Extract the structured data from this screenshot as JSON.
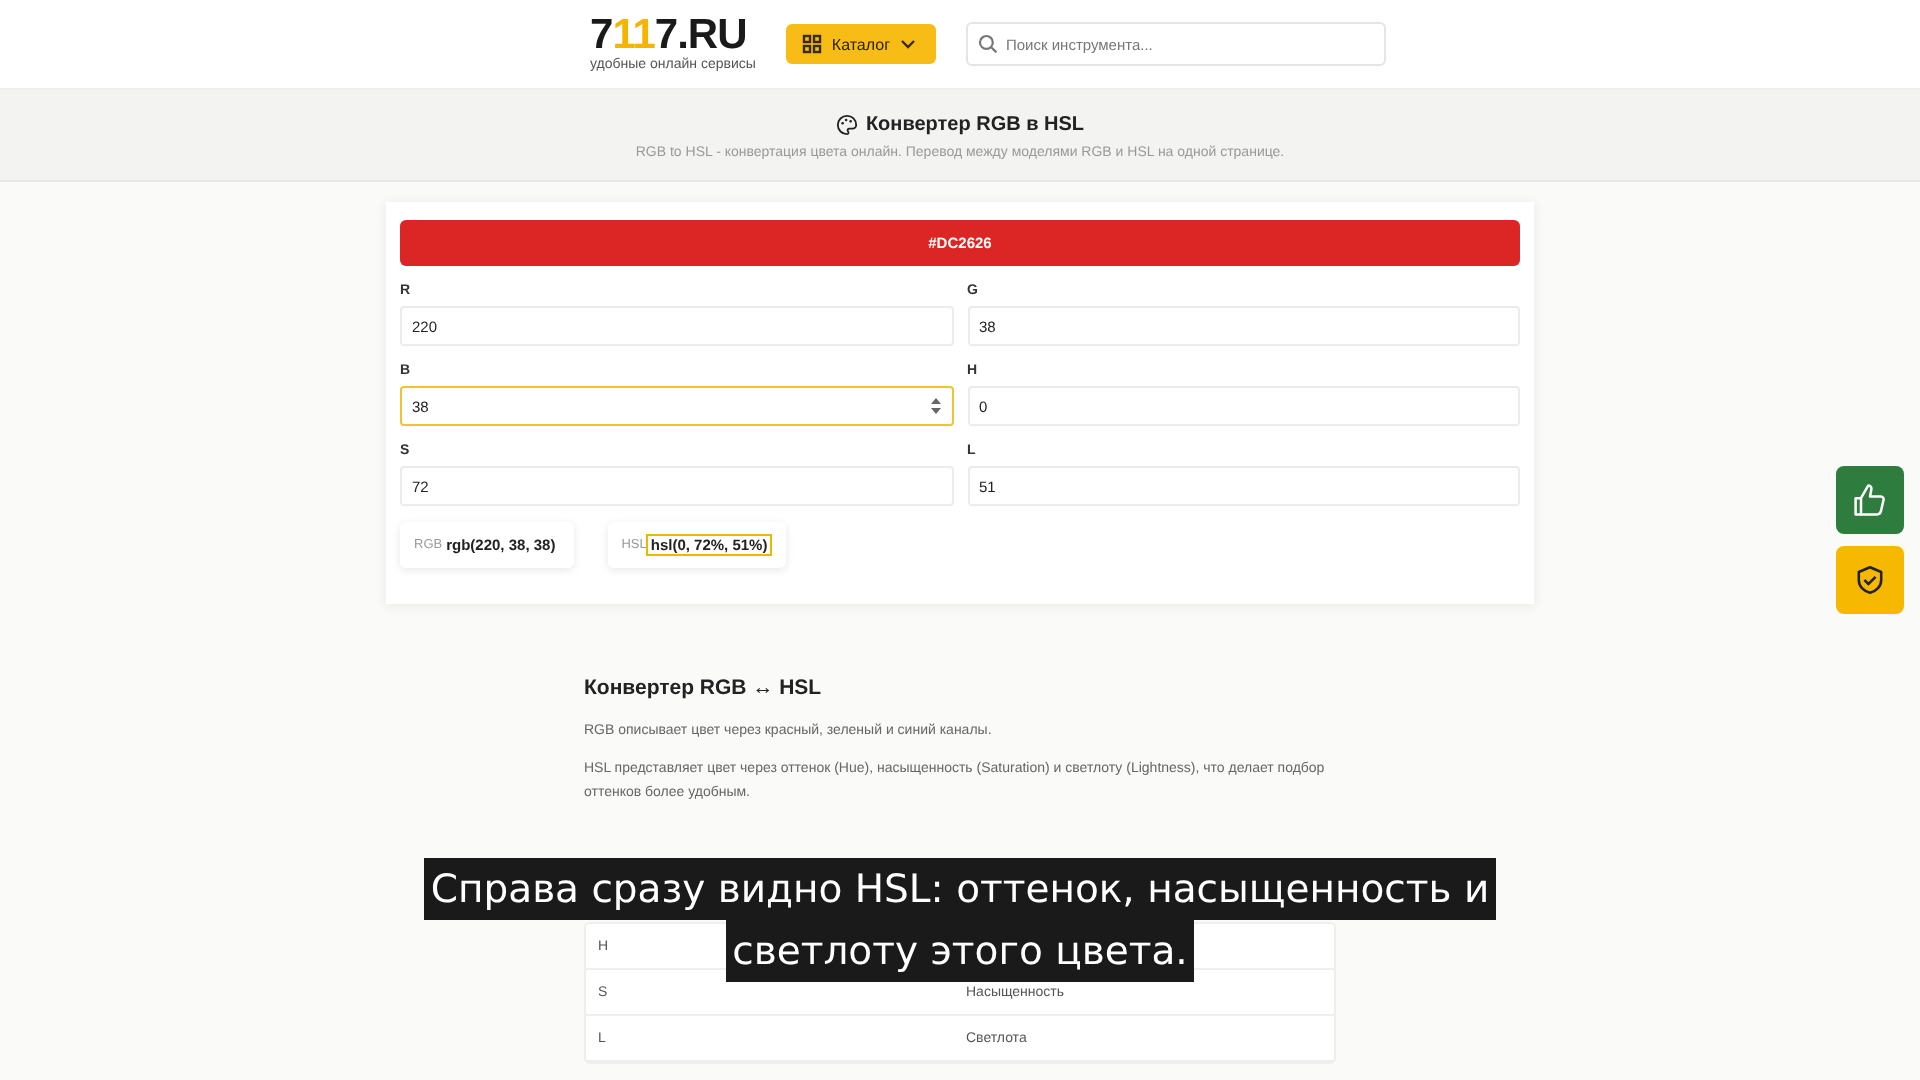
{
  "header": {
    "logo": {
      "prefix": "7",
      "accent": "11",
      "suffix": "7.RU",
      "tagline": "удобные онлайн сервисы"
    },
    "catalog_button": "Каталог",
    "search": {
      "placeholder": "Поиск инструмента..."
    }
  },
  "hero": {
    "title": "Конвертер RGB в HSL",
    "subtitle": "RGB to HSL - конвертация цвета онлайн. Перевод между моделями RGB и HSL на одной странице."
  },
  "converter": {
    "swatch": {
      "label": "#DC2626",
      "color": "#dc2626"
    },
    "fields": [
      {
        "label": "R",
        "value": "220",
        "focused": false
      },
      {
        "label": "G",
        "value": "38",
        "focused": false
      },
      {
        "label": "B",
        "value": "38",
        "focused": true
      },
      {
        "label": "H",
        "value": "0",
        "focused": false
      },
      {
        "label": "S",
        "value": "72",
        "focused": false
      },
      {
        "label": "L",
        "value": "51",
        "focused": false
      }
    ],
    "results": [
      {
        "prefix": "RGB",
        "value": "rgb(220, 38, 38)",
        "selected": false
      },
      {
        "prefix": "HSL",
        "value": "hsl(0, 72%, 51%)",
        "selected": true
      }
    ]
  },
  "article": {
    "heading": "Конвертер RGB ↔ HSL",
    "paragraphs": [
      "RGB описывает цвет через красный, зеленый и синий каналы.",
      "HSL представляет цвет через оттенок (Hue), насыщенность (Saturation) и светлоту (Lightness), что делает подбор оттенков более удобным."
    ],
    "table": [
      {
        "column_1": "H"
      },
      {
        "column_1": "S",
        "column_2": "Насыщенность"
      },
      {
        "column_1": "L",
        "column_2": "Светлота"
      }
    ]
  },
  "caption": [
    "Справа сразу видно HSL: оттенок, насыщенность и",
    "светлоту этого цвета."
  ]
}
